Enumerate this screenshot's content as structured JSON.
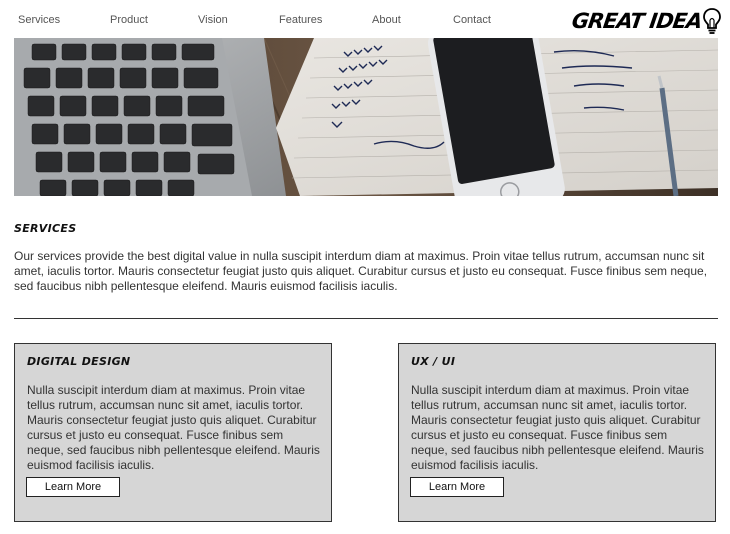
{
  "nav": {
    "items": [
      {
        "label": "Services"
      },
      {
        "label": "Product"
      },
      {
        "label": "Vision"
      },
      {
        "label": "Features"
      },
      {
        "label": "About"
      },
      {
        "label": "Contact"
      }
    ],
    "logo_text": "GREAT IDEA",
    "logo_icon": "lightbulb-icon"
  },
  "hero": {
    "alt_subject": "laptop-keyboard-phone-notebook-photo"
  },
  "services": {
    "title": "SERVICES",
    "body": "Our services provide the best digital value in nulla suscipit interdum diam at maximus. Proin vitae tellus rutrum, accumsan nunc sit amet, iaculis tortor. Mauris consectetur feugiat justo quis aliquet. Curabitur cursus et justo eu consequat. Fusce finibus sem neque, sed faucibus nibh pellentesque eleifend. Mauris euismod facilisis iaculis."
  },
  "cards": [
    {
      "title": "DIGITAL DESIGN",
      "body": "Nulla suscipit interdum diam at maximus. Proin vitae tellus rutrum, accumsan nunc sit amet, iaculis tortor. Mauris consectetur feugiat justo quis aliquet. Curabitur cursus et justo eu consequat. Fusce finibus sem neque, sed faucibus nibh pellentesque eleifend. Mauris euismod facilisis iaculis.",
      "button_label": "Learn More"
    },
    {
      "title": "UX / UI",
      "body": "Nulla suscipit interdum diam at maximus. Proin vitae tellus rutrum, accumsan nunc sit amet, iaculis tortor. Mauris consectetur feugiat justo quis aliquet. Curabitur cursus et justo eu consequat. Fusce finibus sem neque, sed faucibus nibh pellentesque eleifend. Mauris euismod facilisis iaculis.",
      "button_label": "Learn More"
    }
  ],
  "colors": {
    "card_background": "#d6d6d6",
    "text": "#333333",
    "nav_text": "#555555"
  }
}
